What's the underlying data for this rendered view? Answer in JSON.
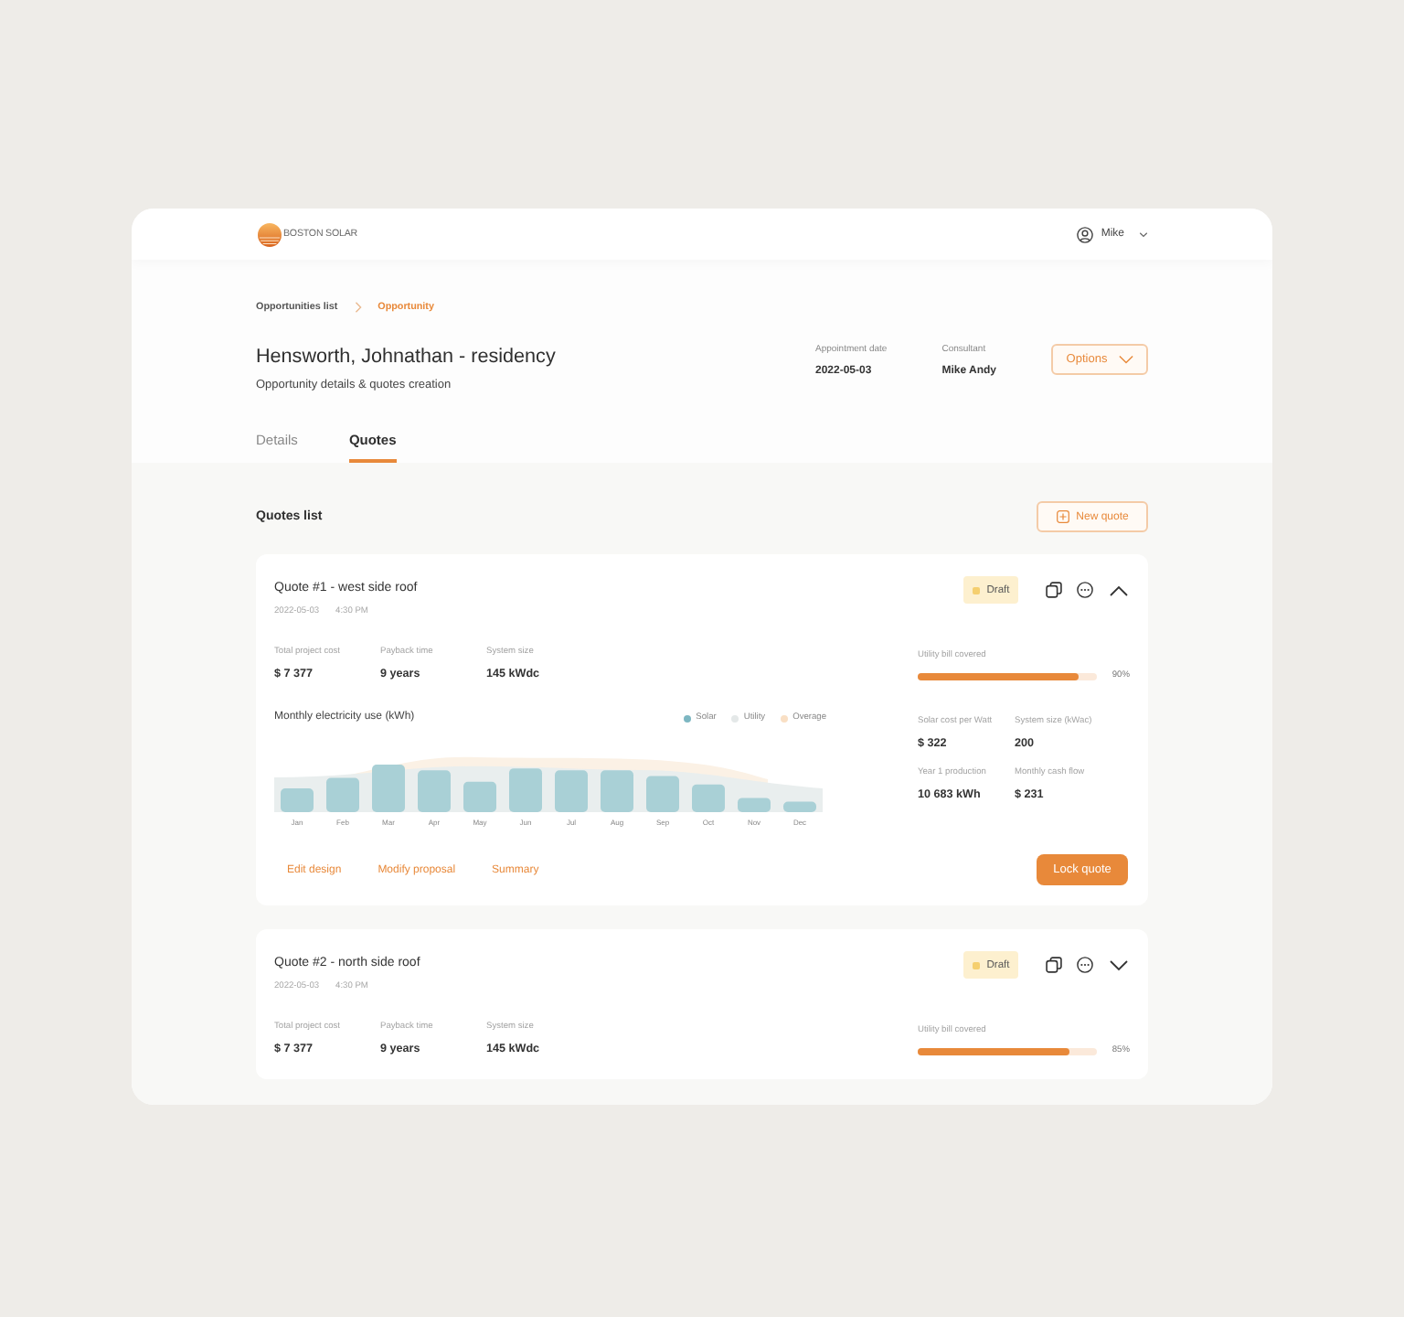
{
  "header": {
    "logo_text": "BOSTON SOLAR",
    "user": "Mike"
  },
  "breadcrumb": [
    {
      "label": "Opportunities list",
      "selected": false
    },
    {
      "label": "Opportunity",
      "selected": true
    }
  ],
  "page": {
    "title": "Hensworth, Johnathan - residency",
    "subtitle": "Opportunity details & quotes creation"
  },
  "meta": [
    {
      "label": "Appointment date",
      "value": "2022-05-03"
    },
    {
      "label": "Consultant",
      "value": "Mike Andy"
    }
  ],
  "options_button": "Options",
  "tabs": [
    {
      "label": "Details",
      "selected": false
    },
    {
      "label": "Quotes",
      "selected": true
    }
  ],
  "quotes_list": {
    "title": "Quotes list",
    "new_button": "New quote"
  },
  "quotes": [
    {
      "title": "Quote #1 - west side roof",
      "date": "2022-05-03",
      "time": "4:30 PM",
      "status": "Draft",
      "expanded": true,
      "stats": [
        {
          "label": "Total project cost",
          "value": "$ 7 377"
        },
        {
          "label": "Payback time",
          "value": "9 years"
        },
        {
          "label": "System size",
          "value": "145 kWdc"
        }
      ],
      "utility": {
        "label": "Utility bill covered",
        "level": 0.9,
        "reading": "90%"
      },
      "chart": {
        "title": "Monthly electricity use (kWh)",
        "legend": [
          {
            "label": "Solar",
            "color": "#7db7c2"
          },
          {
            "label": "Utility",
            "color": "#e4e8e8"
          },
          {
            "label": "Overage",
            "color": "#f9dfc4"
          }
        ],
        "months": [
          "Jan",
          "Feb",
          "Mar",
          "Apr",
          "May",
          "Jun",
          "Jul",
          "Aug",
          "Sep",
          "Oct",
          "Nov",
          "Dec"
        ]
      },
      "details": [
        {
          "label": "Solar cost per Watt",
          "value": "$ 322"
        },
        {
          "label": "System size (kWac)",
          "value": "200"
        },
        {
          "label": "Year 1 production",
          "value": "10 683 kWh"
        },
        {
          "label": "Monthly cash flow",
          "value": "$ 231"
        }
      ],
      "actions": [
        "Edit design",
        "Modify proposal",
        "Summary"
      ],
      "primary_action": "Lock quote"
    },
    {
      "title": "Quote #2 - north side roof",
      "date": "2022-05-03",
      "time": "4:30 PM",
      "status": "Draft",
      "expanded": false,
      "stats": [
        {
          "label": "Total project cost",
          "value": "$ 7 377"
        },
        {
          "label": "Payback time",
          "value": "9 years"
        },
        {
          "label": "System size",
          "value": "145 kWdc"
        }
      ],
      "utility": {
        "label": "Utility bill covered",
        "level": 0.85,
        "reading": "85%"
      }
    }
  ]
}
